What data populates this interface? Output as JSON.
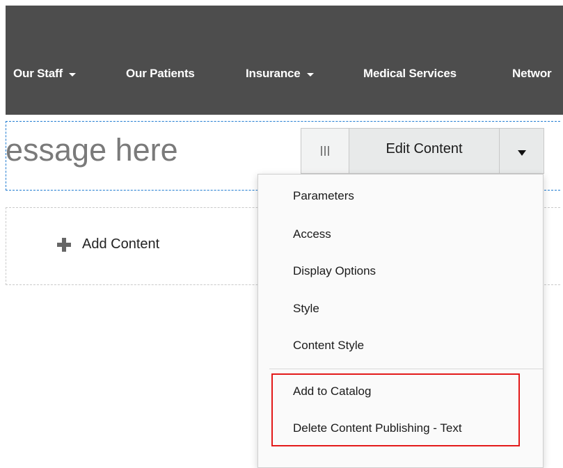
{
  "nav": {
    "items": [
      {
        "label": "Our Staff",
        "dropdown": true
      },
      {
        "label": "Our Patients",
        "dropdown": false
      },
      {
        "label": "Insurance",
        "dropdown": true
      },
      {
        "label": "Medical Services",
        "dropdown": false
      },
      {
        "label": "Networ",
        "dropdown": false
      }
    ]
  },
  "content": {
    "hero_text": "essage here",
    "add_content_label": "Add Content"
  },
  "toolbar": {
    "edit_label": "Edit Content"
  },
  "menu": {
    "items": [
      "Parameters",
      "Access",
      "Display Options",
      "Style",
      "Content Style",
      "Add to Catalog",
      "Delete Content Publishing - Text"
    ]
  },
  "colors": {
    "nav_background": "#4d4d4d",
    "highlight_border": "#e31919",
    "region_border": "#1e7bd1"
  }
}
